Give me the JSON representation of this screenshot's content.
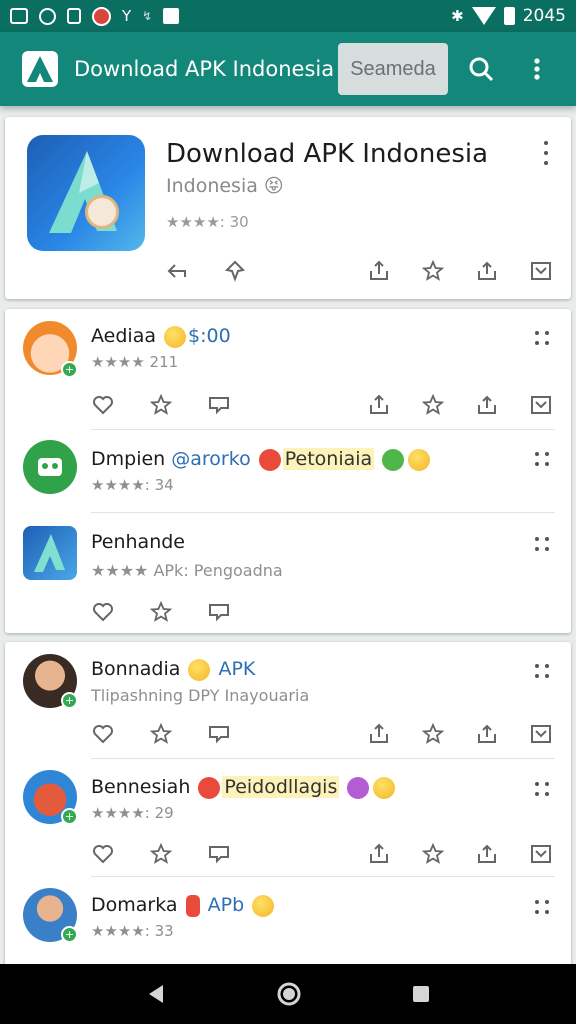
{
  "status_bar": {
    "time": "2045",
    "icons": [
      "landscape-icon",
      "circle-icon",
      "square-icon",
      "pokeball-icon",
      "y-icon",
      "signal-icon",
      "notification-icon"
    ]
  },
  "app_bar": {
    "title": "Download APK Indonesia",
    "search_label": "Seameda"
  },
  "hero": {
    "name": "Download APK Indonesia",
    "subtitle": "Indonesia 😝",
    "rating": "★★★★: 30"
  },
  "items": [
    {
      "name": "Aediaa",
      "emoji": "😬",
      "extra": "$:00",
      "rating": "★★★★ 211"
    },
    {
      "name": "Dmpien",
      "blue": "@arorko",
      "highlight": "Petoniaia",
      "rating": "★★★★: 34"
    },
    {
      "name": "Penhande",
      "rating": "★★★★ APk: Pengoadna"
    },
    {
      "name": "Bonnadia",
      "blue": "APK",
      "sub": "Tlipashning DPY Inayouaria"
    },
    {
      "name": "Bennesiah",
      "highlight": "Peidodllagis",
      "rating": "★★★★: 29"
    },
    {
      "name": "Domarka",
      "blue": "APb",
      "rating": "★★★★: 33"
    }
  ],
  "colors": {
    "appbar": "#12877a",
    "statusbar": "#0a6e61",
    "accent": "#2d6fb3"
  }
}
